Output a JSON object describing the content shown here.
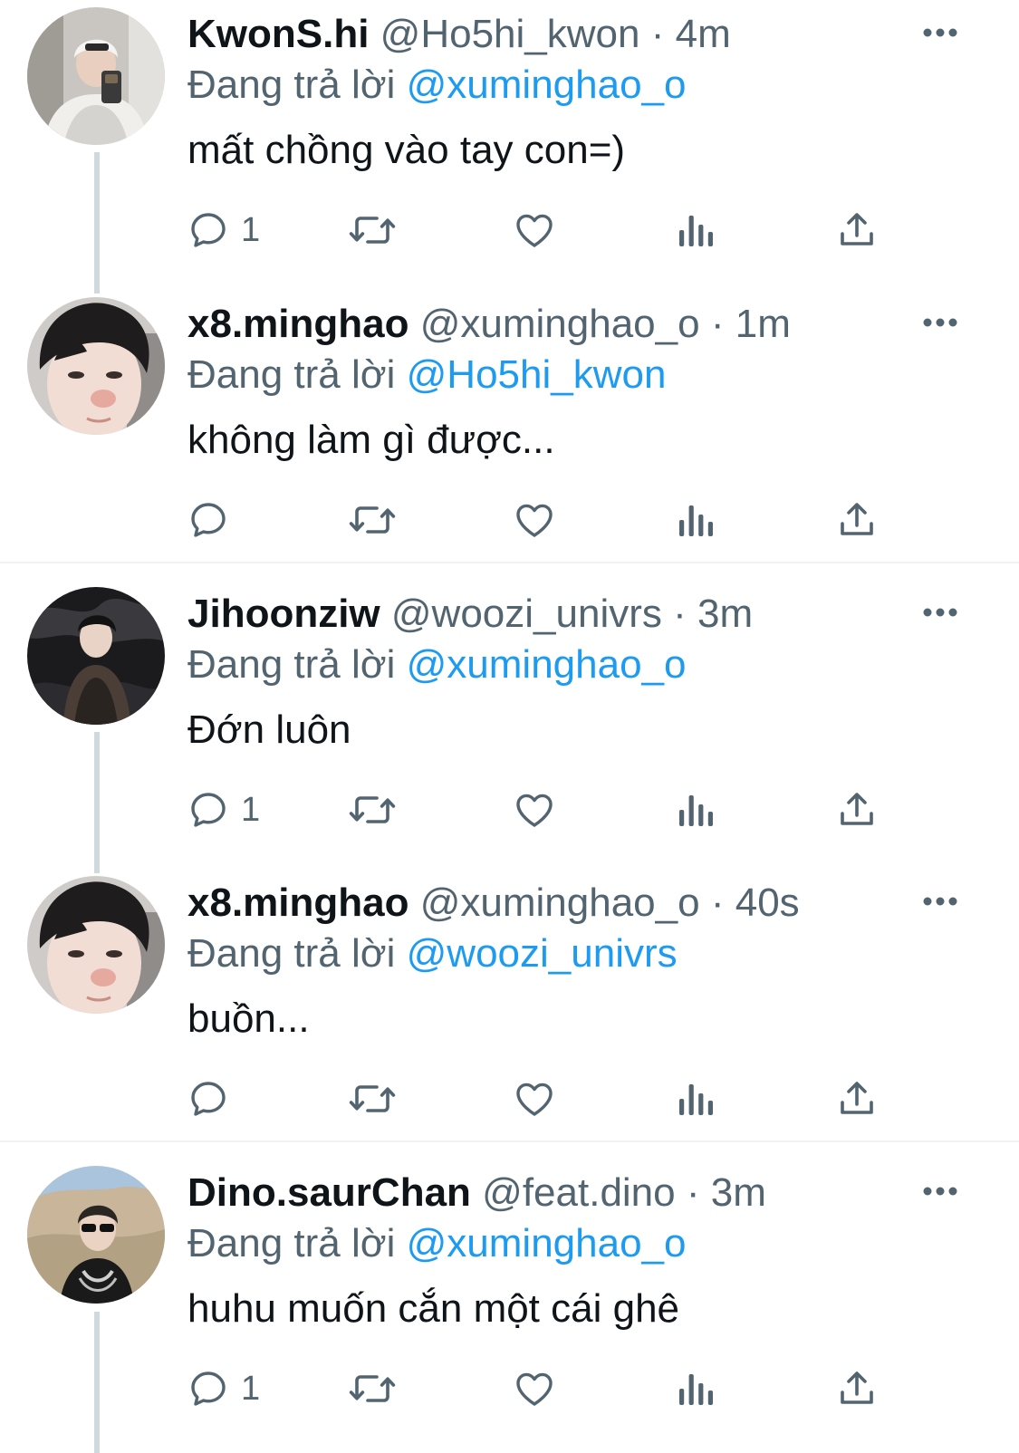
{
  "reply_prefix": "Đang trả lời",
  "colors": {
    "accent": "#1d9bf0",
    "secondary_text": "#536471",
    "icon": "#536471",
    "thread_line": "#cfd9de",
    "separator": "#eff3f4"
  },
  "tweets": [
    {
      "display_name": "KwonS.hi",
      "handle": "@Ho5hi_kwon",
      "dot": "·",
      "time": "4m",
      "reply_to": "@xuminghao_o",
      "text": "mất chồng vào tay con=)",
      "reply_count": "1",
      "avatar_icon": "avatar-light-hair-mirror-selfie"
    },
    {
      "display_name": "x8.minghao",
      "handle": "@xuminghao_o",
      "dot": "·",
      "time": "1m",
      "reply_to": "@Ho5hi_kwon",
      "text": "không làm gì được...",
      "reply_count": "",
      "avatar_icon": "avatar-dark-hair-closeup"
    },
    {
      "display_name": "Jihoonziw",
      "handle": "@woozi_univrs",
      "dot": "·",
      "time": "3m",
      "reply_to": "@xuminghao_o",
      "text": "Đớn luôn",
      "reply_count": "1",
      "avatar_icon": "avatar-dark-outfit-stage"
    },
    {
      "display_name": "x8.minghao",
      "handle": "@xuminghao_o",
      "dot": "·",
      "time": "40s",
      "reply_to": "@woozi_univrs",
      "text": "buồn...",
      "reply_count": "",
      "avatar_icon": "avatar-dark-hair-closeup"
    },
    {
      "display_name": "Dino.saurChan",
      "handle": "@feat.dino",
      "dot": "·",
      "time": "3m",
      "reply_to": "@xuminghao_o",
      "text": "huhu muốn cắn một cái ghê",
      "reply_count": "1",
      "avatar_icon": "avatar-sunglasses-outdoor"
    }
  ]
}
